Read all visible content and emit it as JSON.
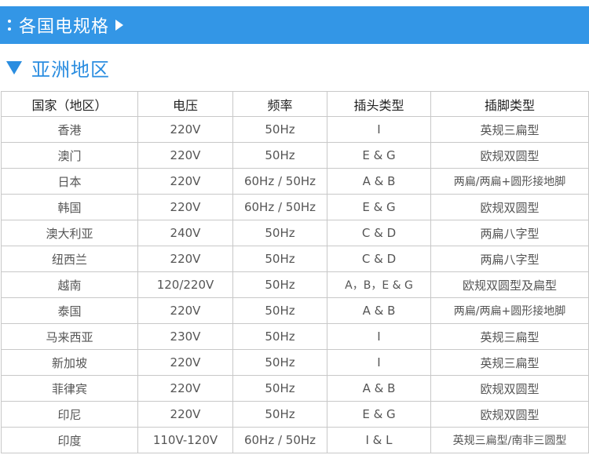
{
  "header": {
    "title": "各国电规格"
  },
  "section": {
    "title": "亚洲地区"
  },
  "table": {
    "columns": [
      "国家（地区）",
      "电压",
      "频率",
      "插头类型",
      "插脚类型"
    ],
    "rows": [
      [
        "香港",
        "220V",
        "50Hz",
        "I",
        "英规三扁型"
      ],
      [
        "澳门",
        "220V",
        "50Hz",
        "E & G",
        "欧规双圆型"
      ],
      [
        "日本",
        "220V",
        "60Hz / 50Hz",
        "A & B",
        "两扁/两扁+圆形接地脚"
      ],
      [
        "韩国",
        "220V",
        "60Hz / 50Hz",
        "E & G",
        "欧规双圆型"
      ],
      [
        "澳大利亚",
        "240V",
        "50Hz",
        "C & D",
        "两扁八字型"
      ],
      [
        "纽西兰",
        "220V",
        "50Hz",
        "C & D",
        "两扁八字型"
      ],
      [
        "越南",
        "120/220V",
        "50Hz",
        "A，B，E & G",
        "欧规双圆型及扁型"
      ],
      [
        "泰国",
        "220V",
        "50Hz",
        "A & B",
        "两扁/两扁+圆形接地脚"
      ],
      [
        "马来西亚",
        "230V",
        "50Hz",
        "I",
        "英规三扁型"
      ],
      [
        "新加坡",
        "220V",
        "50Hz",
        "I",
        "英规三扁型"
      ],
      [
        "菲律宾",
        "220V",
        "50Hz",
        "A & B",
        "欧规双圆型"
      ],
      [
        "印尼",
        "220V",
        "50Hz",
        "E & G",
        "欧规双圆型"
      ],
      [
        "印度",
        "110V-120V",
        "60Hz / 50Hz",
        "I & L",
        "英规三扁型/南非三圆型"
      ]
    ]
  }
}
